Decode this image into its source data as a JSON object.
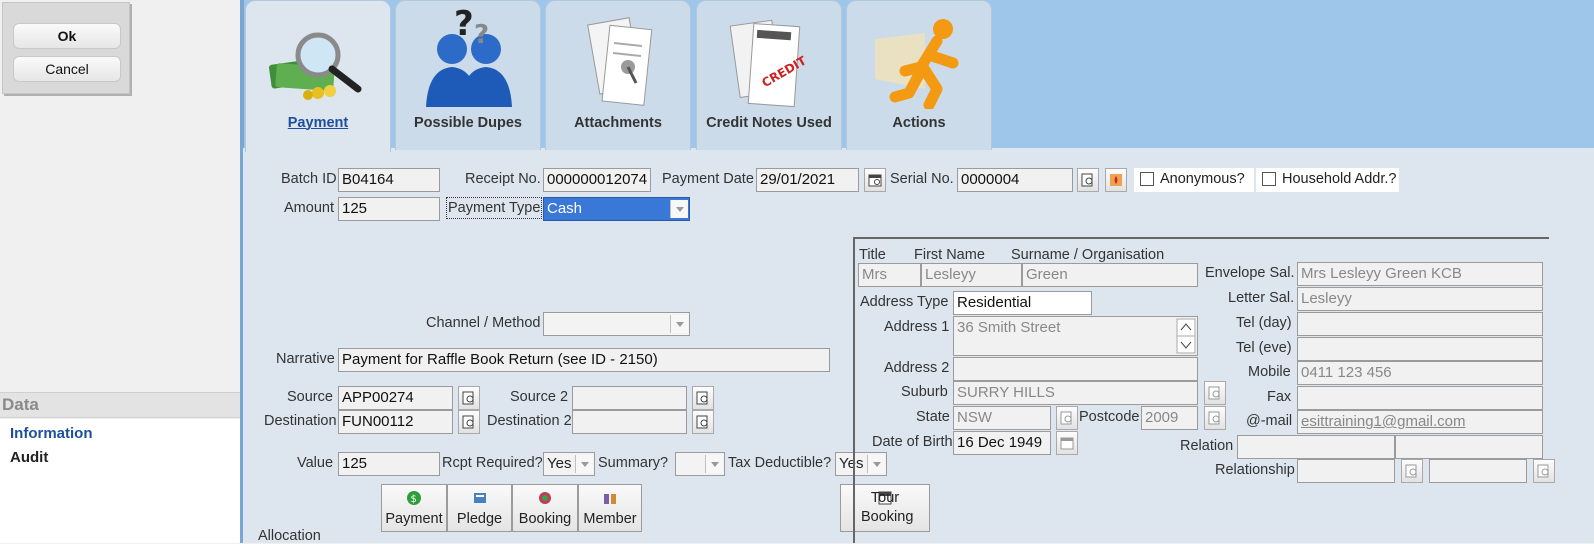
{
  "dialog": {
    "ok_label": "Ok",
    "cancel_label": "Cancel"
  },
  "data_panel": {
    "header": "Data",
    "items": [
      "Information",
      "Audit"
    ]
  },
  "tabs": [
    {
      "label": "Payment",
      "icon": "money-search-icon"
    },
    {
      "label": "Possible Dupes",
      "icon": "people-question-icon"
    },
    {
      "label": "Attachments",
      "icon": "invoice-pin-icon"
    },
    {
      "label": "Credit Notes Used",
      "icon": "invoice-credit-icon"
    },
    {
      "label": "Actions",
      "icon": "running-man-icon"
    }
  ],
  "payment": {
    "batch_id_label": "Batch ID",
    "batch_id": "B04164",
    "receipt_no_label": "Receipt No.",
    "receipt_no": "000000012074",
    "payment_date_label": "Payment Date",
    "payment_date": "29/01/2021",
    "serial_no_label": "Serial No.",
    "serial_no": "0000004",
    "anonymous_label": "Anonymous?",
    "household_label": "Household Addr.?",
    "amount_label": "Amount",
    "amount": "125",
    "payment_type_label": "Payment Type",
    "payment_type": "Cash",
    "channel_label": "Channel / Method",
    "channel": "",
    "narrative_label": "Narrative",
    "narrative": "Payment for Raffle Book Return (see ID - 2150)",
    "source_label": "Source",
    "source": "APP00274",
    "source2_label": "Source 2",
    "source2": "",
    "destination_label": "Destination",
    "destination": "FUN00112",
    "destination2_label": "Destination 2",
    "destination2": "",
    "value_label": "Value",
    "value": "125",
    "rcpt_required_label": "Rcpt Required?",
    "rcpt_required": "Yes",
    "summary_label": "Summary?",
    "summary": "",
    "tax_deductible_label": "Tax Deductible?",
    "tax_deductible": "Yes",
    "allocation_label": "Allocation"
  },
  "alloc_buttons": [
    {
      "label": "Payment",
      "icon": "dollar-icon",
      "color": "#2e9e3a"
    },
    {
      "label": "Pledge",
      "icon": "pledge-icon",
      "color": "#4a7fc0"
    },
    {
      "label": "Booking",
      "icon": "booking-icon",
      "color": "#c03a5a"
    },
    {
      "label": "Member",
      "icon": "member-icon",
      "color": "#7a5ca8"
    }
  ],
  "tour_booking_label": "Tour Booking",
  "contact": {
    "title_label": "Title",
    "title": "Mrs",
    "first_name_label": "First Name",
    "first_name": "Lesleyy",
    "surname_label": "Surname / Organisation",
    "surname": "Green",
    "address_type_label": "Address Type",
    "address_type": "Residential",
    "address1_label": "Address 1",
    "address1": "36 Smith Street",
    "address2_label": "Address 2",
    "address2": "",
    "suburb_label": "Suburb",
    "suburb": "SURRY HILLS",
    "state_label": "State",
    "state": "NSW",
    "postcode_label": "Postcode",
    "postcode": "2009",
    "dob_label": "Date of Birth",
    "dob": "16 Dec 1949",
    "envelope_sal_label": "Envelope Sal.",
    "envelope_sal": "Mrs Lesleyy Green KCB",
    "letter_sal_label": "Letter Sal.",
    "letter_sal": "Lesleyy",
    "tel_day_label": "Tel (day)",
    "tel_day": "",
    "tel_eve_label": "Tel (eve)",
    "tel_eve": "",
    "mobile_label": "Mobile",
    "mobile": "0411 123 456",
    "fax_label": "Fax",
    "fax": "",
    "email_label": "@-mail",
    "email": "esittraining1@gmail.com",
    "relation_label": "Relation",
    "relation": "",
    "relationship_label": "Relationship",
    "relationship": ""
  },
  "colors": {
    "tab_bar": "#9ec5ea",
    "content_bg": "#dde6ef",
    "accent": "#1d4f9f",
    "selected": "#3a78d8"
  }
}
